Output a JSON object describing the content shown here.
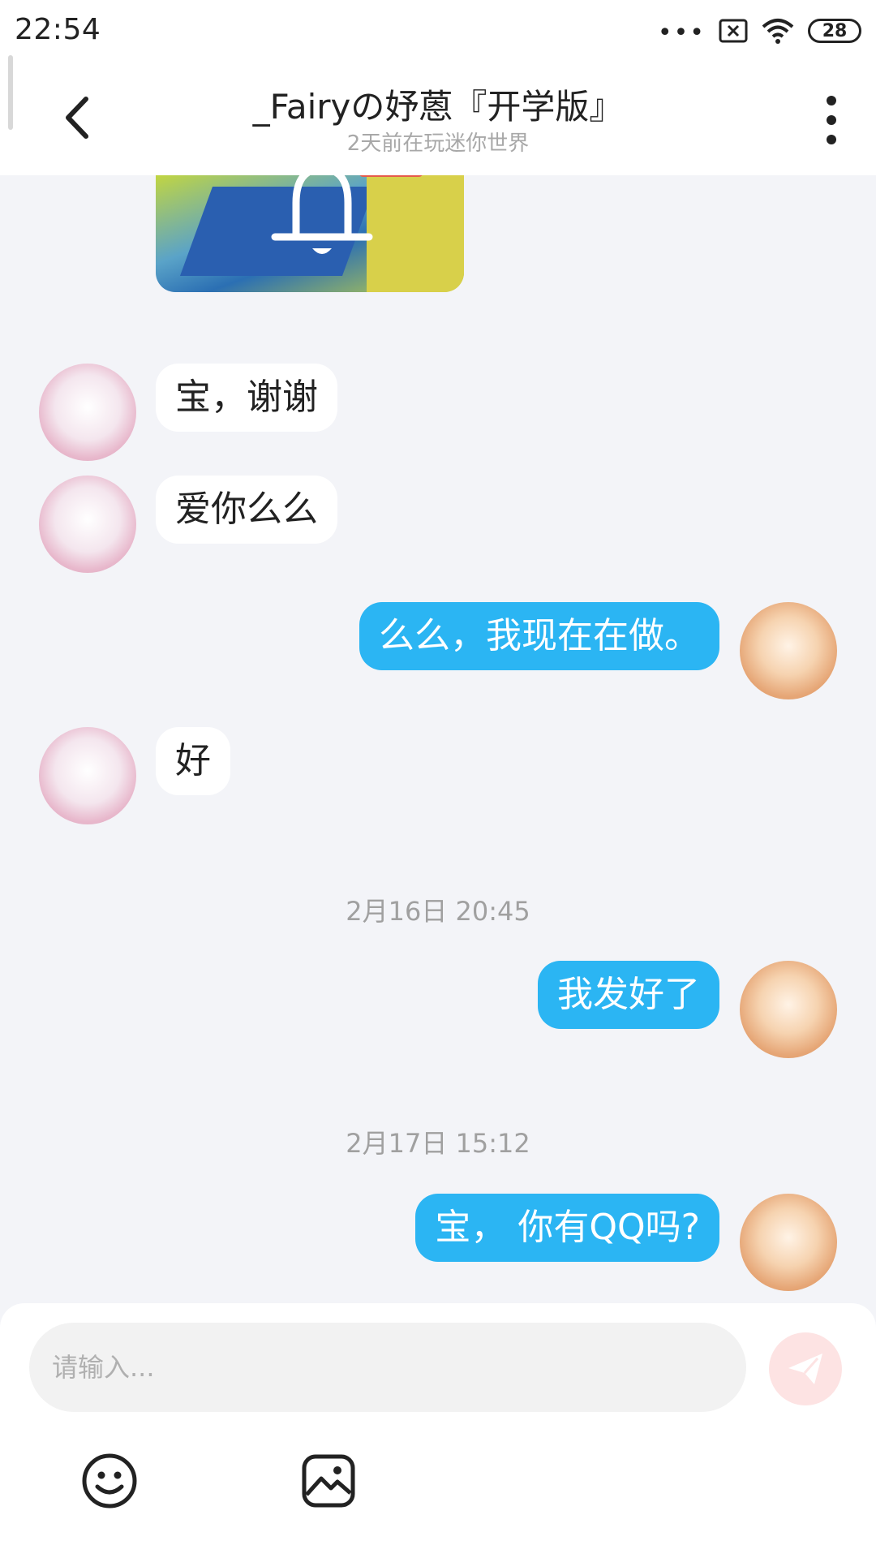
{
  "status_bar": {
    "time": "22:54",
    "battery": "28"
  },
  "header": {
    "title": "_Fairyの妤蒽『开学版』",
    "subtitle": "2天前在玩迷你世界"
  },
  "messages": [
    {
      "side": "in",
      "text": "宝，谢谢"
    },
    {
      "side": "in",
      "text": "爱你么么"
    },
    {
      "side": "out",
      "text": "么么，我现在在做。"
    },
    {
      "side": "in",
      "text": "好"
    },
    {
      "side": "out",
      "text": "我发好了"
    },
    {
      "side": "out",
      "text": "宝，  你有QQ吗?"
    }
  ],
  "timestamps": [
    "2月16日 20:45",
    "2月17日 15:12"
  ],
  "input": {
    "placeholder": "请输入..."
  },
  "colors": {
    "outgoing_bubble": "#2bb5f3",
    "incoming_bubble": "#ffffff",
    "send_button": "#fde3e3"
  }
}
